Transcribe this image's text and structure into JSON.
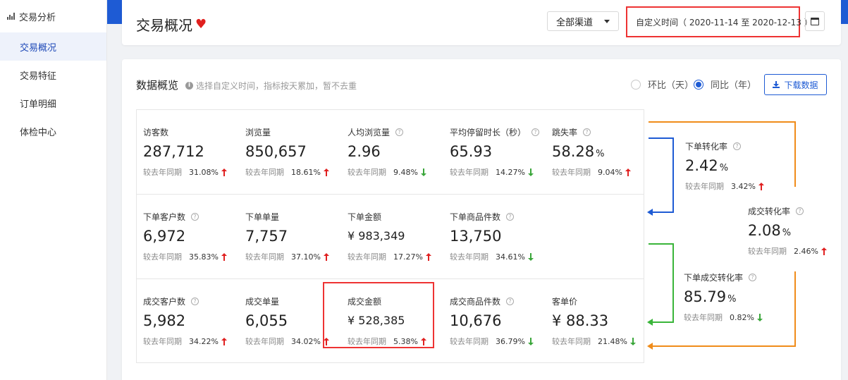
{
  "sidebar": {
    "title": "交易分析",
    "items": [
      {
        "label": "交易概况",
        "active": true
      },
      {
        "label": "交易特征",
        "active": false
      },
      {
        "label": "订单明细",
        "active": false
      },
      {
        "label": "体检中心",
        "active": false
      }
    ]
  },
  "header": {
    "title": "交易概况",
    "channel": "全部渠道",
    "date_range": "自定义时间（ 2020-11-14 至 2020-12-13 ）",
    "calendar_icon": "calendar-icon"
  },
  "overview": {
    "title": "数据概览",
    "hint": "选择自定义时间，指标按天累加，暂不去重",
    "radio_day": "环比（天）",
    "radio_year": "同比（年）",
    "selected": "year",
    "download": "下载数据"
  },
  "compare_label": "较去年同期",
  "colors": {
    "up": "#e02020",
    "down": "#3aa63a",
    "accent": "#1e5bd4",
    "highlight": "#e33333"
  },
  "metrics": [
    {
      "label": "访客数",
      "value": "287,712",
      "unit": "",
      "help": false,
      "pct": "31.08%",
      "dir": "up"
    },
    {
      "label": "浏览量",
      "value": "850,657",
      "unit": "",
      "help": false,
      "pct": "18.61%",
      "dir": "up"
    },
    {
      "label": "人均浏览量",
      "value": "2.96",
      "unit": "",
      "help": true,
      "pct": "9.48%",
      "dir": "down"
    },
    {
      "label": "平均停留时长（秒）",
      "value": "65.93",
      "unit": "",
      "help": true,
      "pct": "14.27%",
      "dir": "down"
    },
    {
      "label": "跳失率",
      "value": "58.28",
      "unit": "%",
      "help": true,
      "pct": "9.04%",
      "dir": "up"
    },
    {
      "label": "下单客户数",
      "value": "6,972",
      "unit": "",
      "help": true,
      "pct": "35.83%",
      "dir": "up"
    },
    {
      "label": "下单单量",
      "value": "7,757",
      "unit": "",
      "help": false,
      "pct": "37.10%",
      "dir": "up"
    },
    {
      "label": "下单金额",
      "value": "¥ 983,349",
      "unit": "",
      "help": false,
      "pct": "17.27%",
      "dir": "up",
      "money": true
    },
    {
      "label": "下单商品件数",
      "value": "13,750",
      "unit": "",
      "help": true,
      "pct": "34.61%",
      "dir": "down"
    },
    {
      "label": "成交客户数",
      "value": "5,982",
      "unit": "",
      "help": true,
      "pct": "34.22%",
      "dir": "up"
    },
    {
      "label": "成交单量",
      "value": "6,055",
      "unit": "",
      "help": false,
      "pct": "34.02%",
      "dir": "up"
    },
    {
      "label": "成交金额",
      "value": "¥ 528,385",
      "unit": "",
      "help": false,
      "pct": "5.38%",
      "dir": "up",
      "money": true
    },
    {
      "label": "成交商品件数",
      "value": "10,676",
      "unit": "",
      "help": true,
      "pct": "36.79%",
      "dir": "down"
    },
    {
      "label": "客单价",
      "value": "¥ 88.33",
      "unit": "",
      "help": false,
      "pct": "21.48%",
      "dir": "down"
    }
  ],
  "conversions": [
    {
      "label": "下单转化率",
      "value": "2.42",
      "unit": "%",
      "help": true,
      "pct": "3.42%",
      "dir": "up"
    },
    {
      "label": "成交转化率",
      "value": "2.08",
      "unit": "%",
      "help": true,
      "pct": "2.46%",
      "dir": "up"
    },
    {
      "label": "下单成交转化率",
      "value": "85.79",
      "unit": "%",
      "help": true,
      "pct": "0.82%",
      "dir": "down"
    }
  ]
}
